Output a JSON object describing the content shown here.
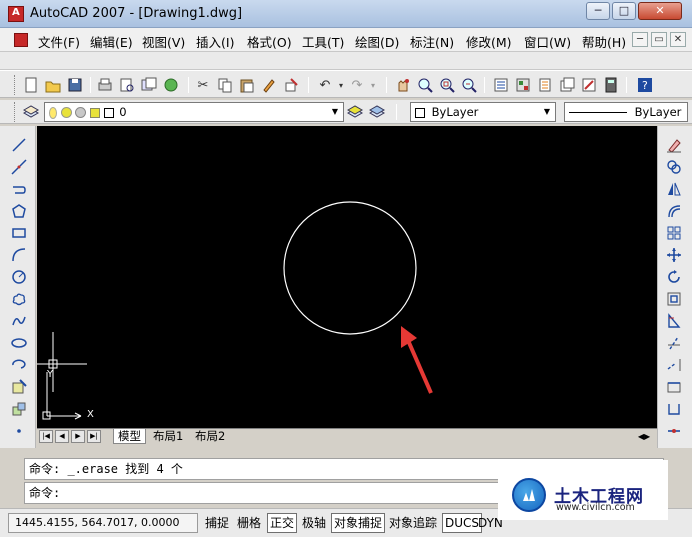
{
  "window": {
    "title": "AutoCAD 2007 - [Drawing1.dwg]",
    "buttons": {
      "minimize": "─",
      "maximize": "□",
      "close": "✕"
    }
  },
  "menu": {
    "items": [
      "文件(F)",
      "编辑(E)",
      "视图(V)",
      "插入(I)",
      "格式(O)",
      "工具(T)",
      "绘图(D)",
      "标注(N)",
      "修改(M)",
      "窗口(W)",
      "帮助(H)"
    ],
    "mdi_buttons": {
      "minimize": "─",
      "restore": "▭",
      "close": "✕"
    }
  },
  "layer_toolbar": {
    "current_layer": "0",
    "color": "ByLayer",
    "linetype": "ByLayer"
  },
  "layout_tabs": {
    "nav": [
      "|◀",
      "◀",
      "▶",
      "▶|"
    ],
    "tabs": [
      "模型",
      "布局1",
      "布局2"
    ],
    "active": "模型"
  },
  "ucs": {
    "x_label": "X",
    "y_label": "Y"
  },
  "command": {
    "history": "命令: _.erase 找到 4 个",
    "prompt": "命令:"
  },
  "status": {
    "coordinates": "1445.4155, 564.7017, 0.0000",
    "toggles": [
      {
        "label": "捕捉",
        "on": false
      },
      {
        "label": "栅格",
        "on": false
      },
      {
        "label": "正交",
        "on": true
      },
      {
        "label": "极轴",
        "on": false
      },
      {
        "label": "对象捕捉",
        "on": true
      },
      {
        "label": "对象追踪",
        "on": false
      },
      {
        "label": "DUCS",
        "on": true
      },
      {
        "label": "DYN",
        "on": false
      }
    ]
  },
  "watermark": {
    "title": "土木工程网",
    "url": "www.civilcn.com"
  },
  "colors": {
    "canvas": "#000000",
    "circle": "#ffffff",
    "annotation_arrow": "#e53935",
    "brand_blue": "#1565c0"
  }
}
